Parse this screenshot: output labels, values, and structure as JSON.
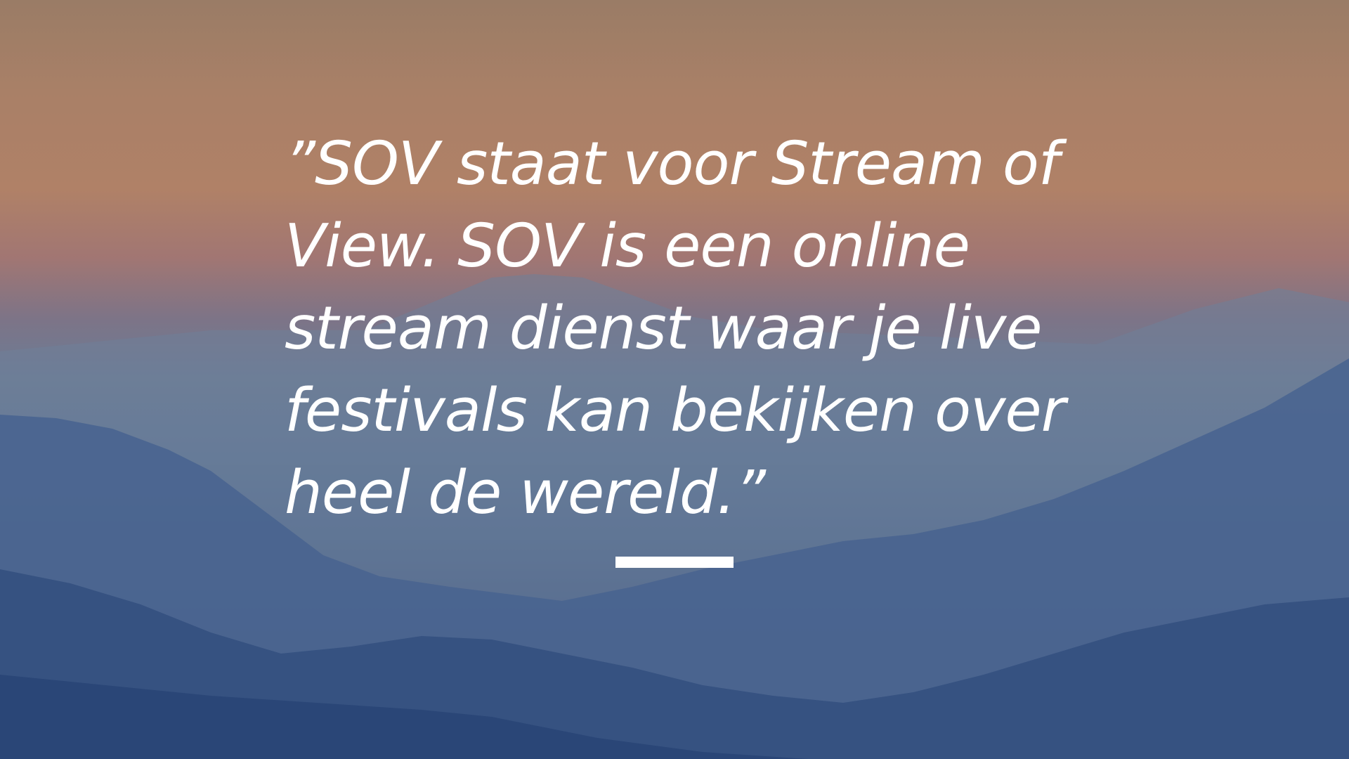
{
  "slide": {
    "quote": "”SOV staat voor Stream of View. SOV is een online stream dienst waar je live festivals kan bekijken over heel de wereld.”"
  },
  "colors": {
    "text": "#ffffff",
    "sky_top": "#9a7c66",
    "sky_mid": "#b08167",
    "haze": "#6a7c96",
    "mountain_dark": "#2a4677"
  }
}
